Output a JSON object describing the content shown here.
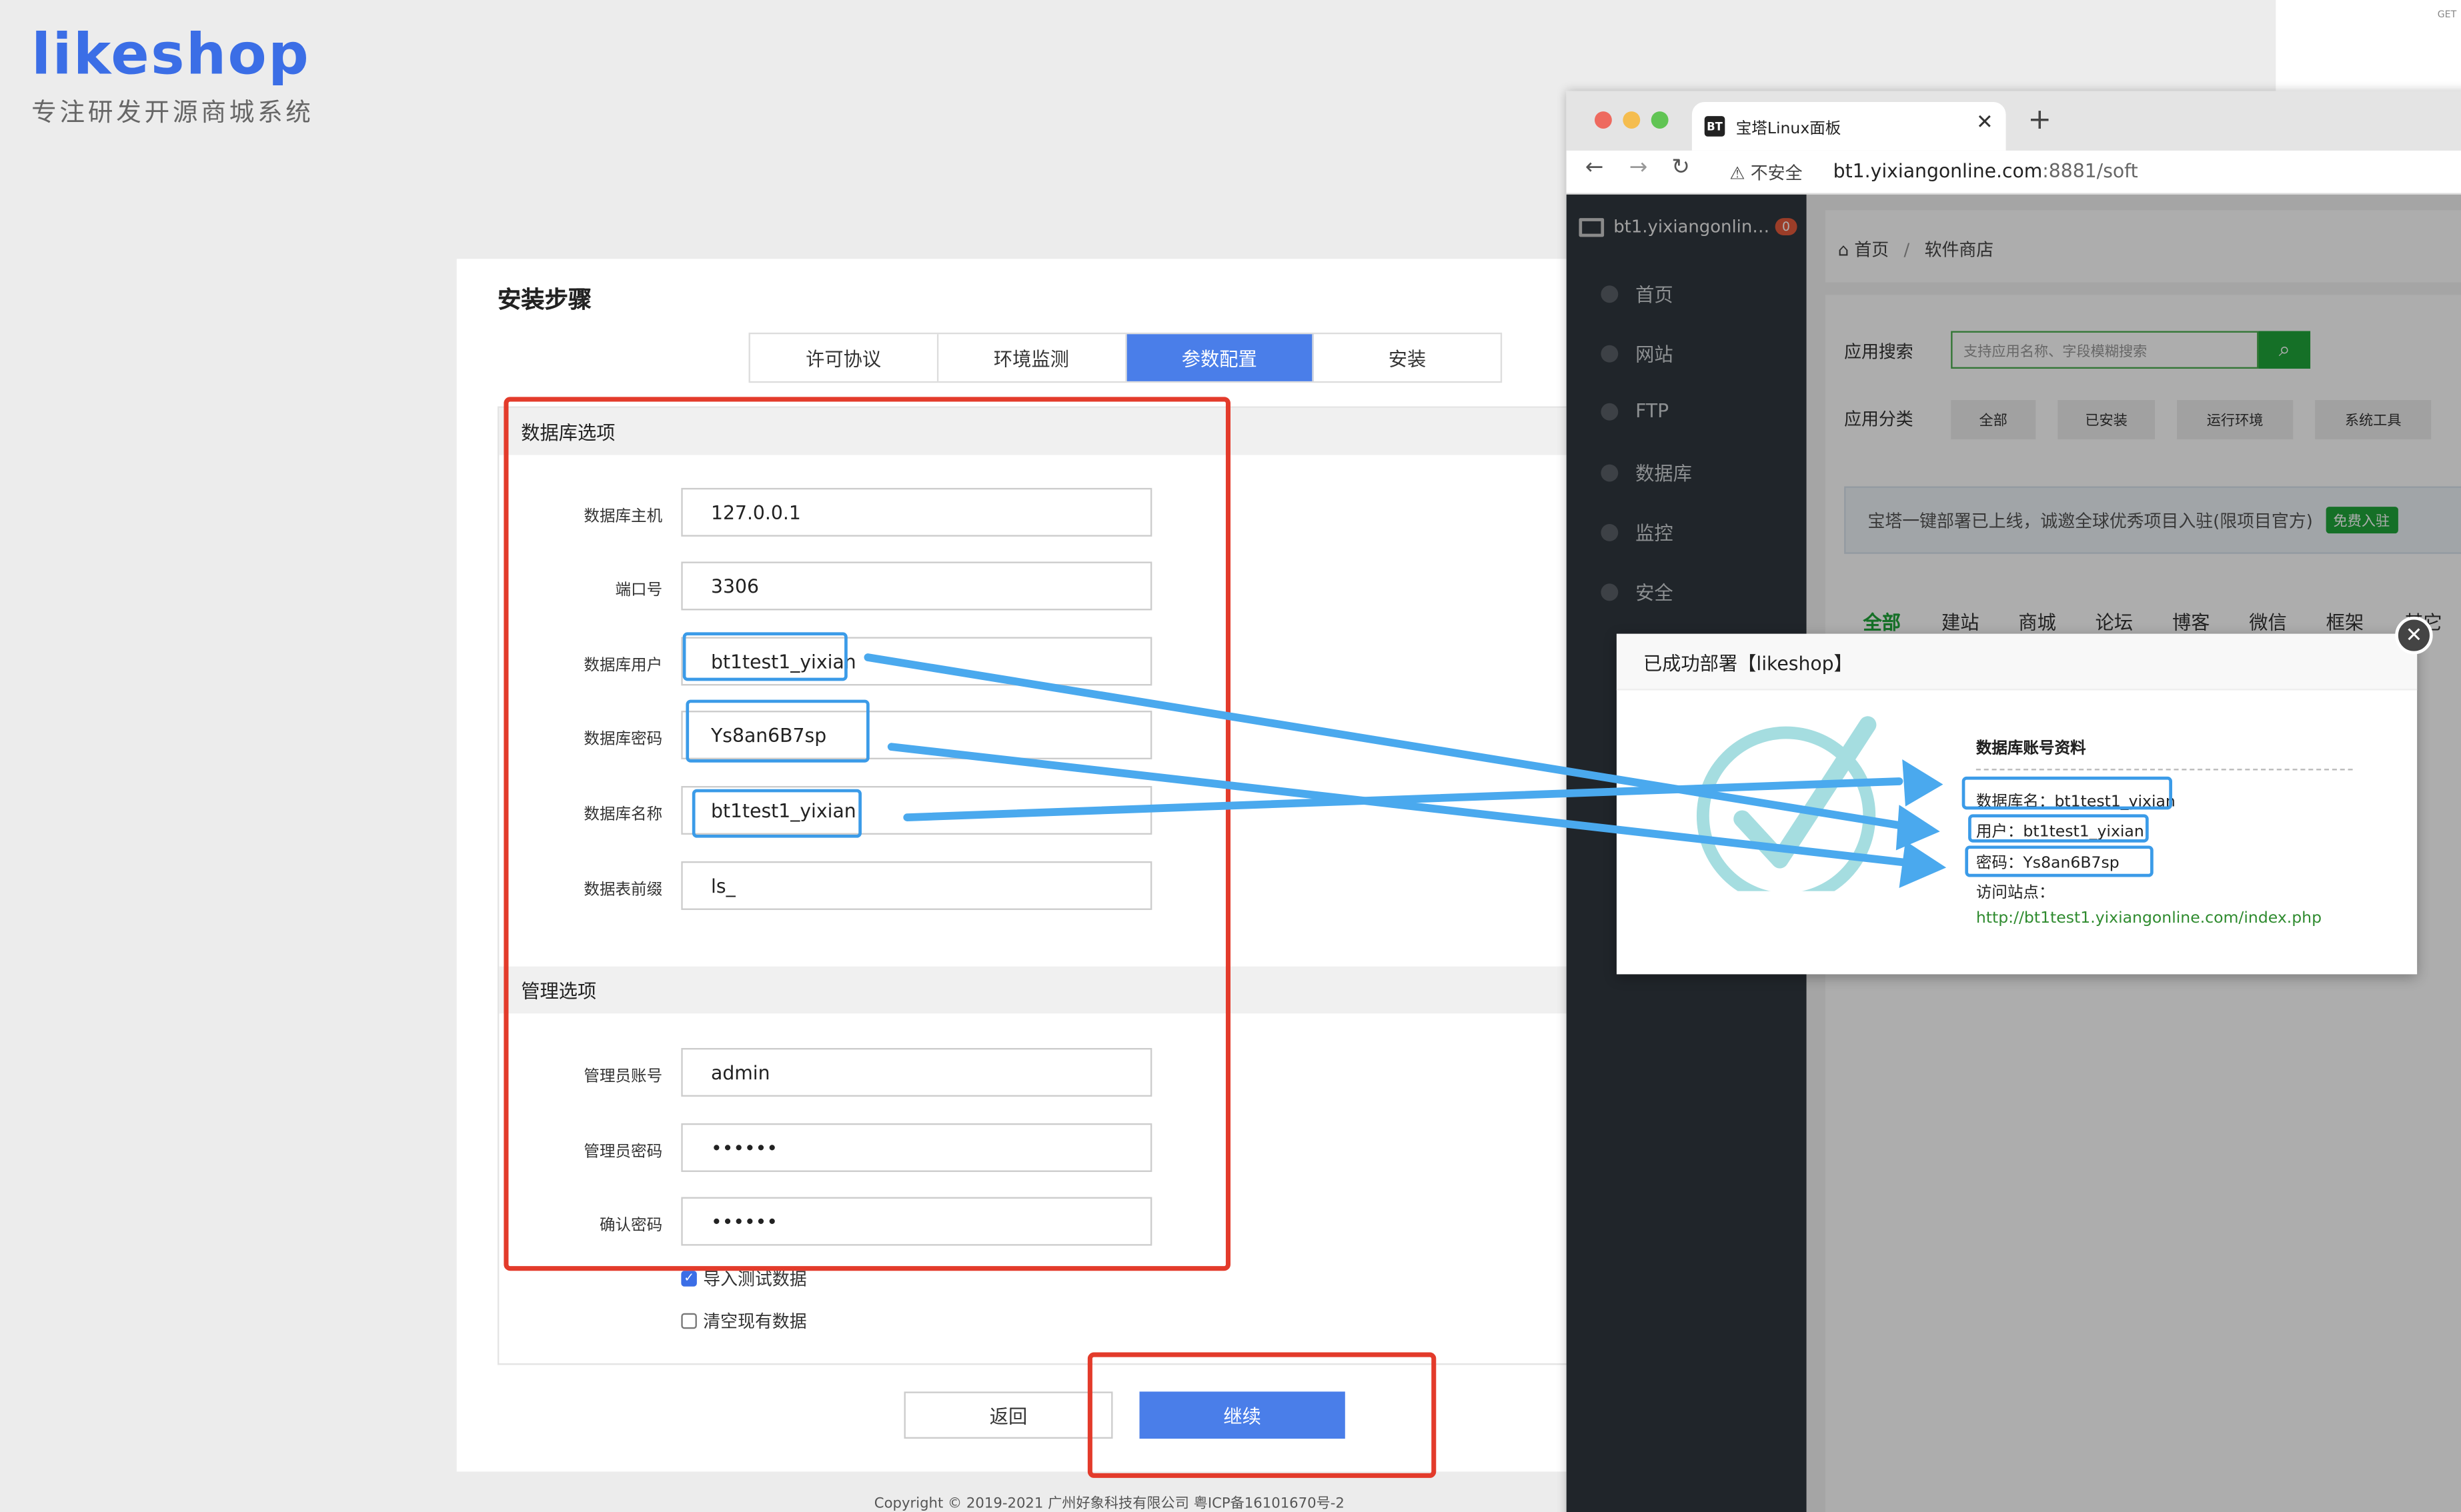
{
  "logo": {
    "name": "likeshop",
    "slogan": "专注研发开源商城系统"
  },
  "installer": {
    "title": "安装步骤",
    "steps": [
      {
        "label": "许可协议",
        "active": false
      },
      {
        "label": "环境监测",
        "active": false
      },
      {
        "label": "参数配置",
        "active": true
      },
      {
        "label": "安装",
        "active": false
      }
    ],
    "db_section": "数据库选项",
    "db_fields": [
      {
        "label": "数据库主机",
        "value": "127.0.0.1"
      },
      {
        "label": "端口号",
        "value": "3306"
      },
      {
        "label": "数据库用户",
        "value": "bt1test1_yixian"
      },
      {
        "label": "数据库密码",
        "value": "Ys8an6B7sp"
      },
      {
        "label": "数据库名称",
        "value": "bt1test1_yixian"
      },
      {
        "label": "数据表前缀",
        "value": "ls_"
      }
    ],
    "admin_section": "管理选项",
    "admin_fields": [
      {
        "label": "管理员账号",
        "value": "admin"
      },
      {
        "label": "管理员密码",
        "value": "••••••"
      },
      {
        "label": "确认密码",
        "value": "••••••"
      }
    ],
    "checkbox_import": "导入测试数据",
    "checkbox_clear": "清空现有数据",
    "btn_back": "返回",
    "btn_next": "继续",
    "footer": "Copyright © 2019-2021 广州好象科技有限公司 粤ICP备16101670号-2"
  },
  "browser": {
    "tab_icon": "BT",
    "tab_title": "宝塔Linux面板",
    "insecure": "不安全",
    "url_host": "bt1.yixiangonline.com",
    "url_rest": ":8881/soft",
    "colors": {
      "close": "#ee6a5f",
      "min": "#f5bd4f",
      "max": "#61c454"
    }
  },
  "bt": {
    "host": "bt1.yixiangonlin…",
    "badge": "0",
    "sidebar": [
      "首页",
      "网站",
      "FTP",
      "数据库",
      "监控",
      "安全"
    ],
    "crumb_home": "首页",
    "crumb_sep": "/",
    "crumb_current": "软件商店",
    "search_label": "应用搜索",
    "search_placeholder": "支持应用名称、字段模糊搜索",
    "cat_label": "应用分类",
    "cats": [
      "全部",
      "已安装",
      "运行环境",
      "系统工具"
    ],
    "notice": "宝塔一键部署已上线，诚邀全球优秀项目入驻(限项目官方)",
    "notice_btn": "免费入驻",
    "filter_tabs": [
      "全部",
      "建站",
      "商城",
      "论坛",
      "博客",
      "微信",
      "框架",
      "其它"
    ]
  },
  "modal": {
    "title": "已成功部署【likeshop】",
    "info_title": "数据库账号资料",
    "db_name_label": "数据库名：",
    "db_name": "bt1test1_yixian",
    "user_label": "用户：",
    "user": "bt1test1_yixian",
    "pass_label": "密码：",
    "pass": "Ys8an6B7sp",
    "site_label": "访问站点：",
    "site_url": "http://bt1test1.yixiangonline.com/index.php"
  },
  "corner_text": "GET",
  "colors": {
    "accent": "#4a7ee9",
    "highlight_red": "#e33b2b",
    "highlight_blue": "#3b9be8",
    "bt_green": "#20a53a"
  }
}
